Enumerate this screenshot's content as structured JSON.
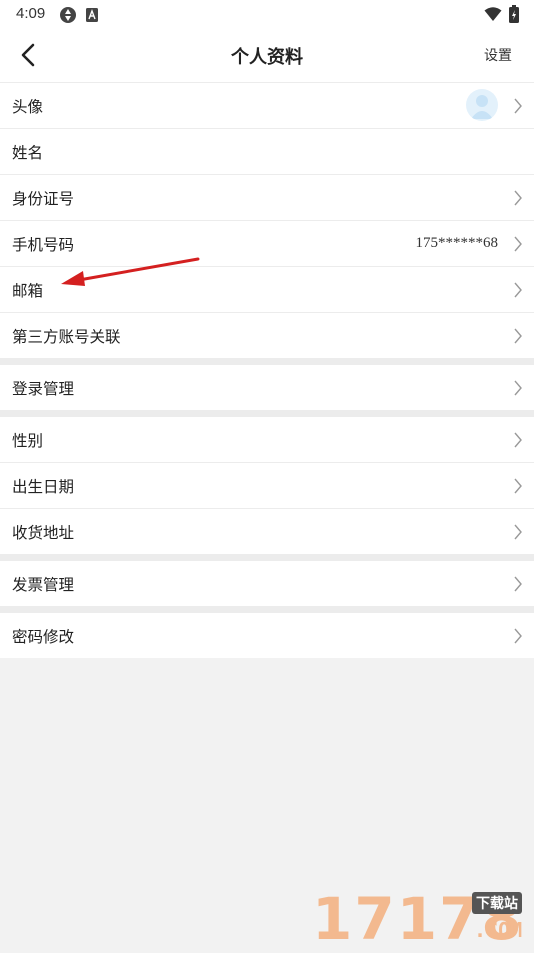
{
  "status_bar": {
    "time": "4:09",
    "icons": [
      "sync-icon",
      "a-notification-icon",
      "wifi-icon",
      "battery-charging-icon"
    ]
  },
  "nav": {
    "title": "个人资料",
    "settings_label": "设置",
    "back_icon": "chevron-left-icon"
  },
  "sections": [
    {
      "rows": [
        {
          "label": "头像",
          "value": "",
          "has_avatar": true,
          "chevron": true
        },
        {
          "label": "姓名",
          "value": "",
          "chevron": false
        },
        {
          "label": "身份证号",
          "value": "",
          "chevron": true
        },
        {
          "label": "手机号码",
          "value": "175******68",
          "chevron": true
        },
        {
          "label": "邮箱",
          "value": "",
          "chevron": true
        },
        {
          "label": "第三方账号关联",
          "value": "",
          "chevron": true
        }
      ]
    },
    {
      "rows": [
        {
          "label": "登录管理",
          "value": "",
          "chevron": true
        }
      ]
    },
    {
      "rows": [
        {
          "label": "性别",
          "value": "",
          "chevron": true
        },
        {
          "label": "出生日期",
          "value": "",
          "chevron": true
        },
        {
          "label": "收货地址",
          "value": "",
          "chevron": true
        }
      ]
    },
    {
      "rows": [
        {
          "label": "发票管理",
          "value": "",
          "chevron": true
        }
      ]
    },
    {
      "rows": [
        {
          "label": "密码修改",
          "value": "",
          "chevron": true
        }
      ]
    }
  ],
  "annotation": {
    "type": "red-arrow",
    "points_to": "邮箱",
    "color": "#d42020"
  },
  "watermark": {
    "number": "17178",
    "tag": "下载站",
    "domain": ".COM"
  },
  "colors": {
    "background": "#f2f2f2",
    "divider": "#ececec",
    "watermark": "#f3b98f",
    "avatar_bg": "#e3f1fb"
  }
}
